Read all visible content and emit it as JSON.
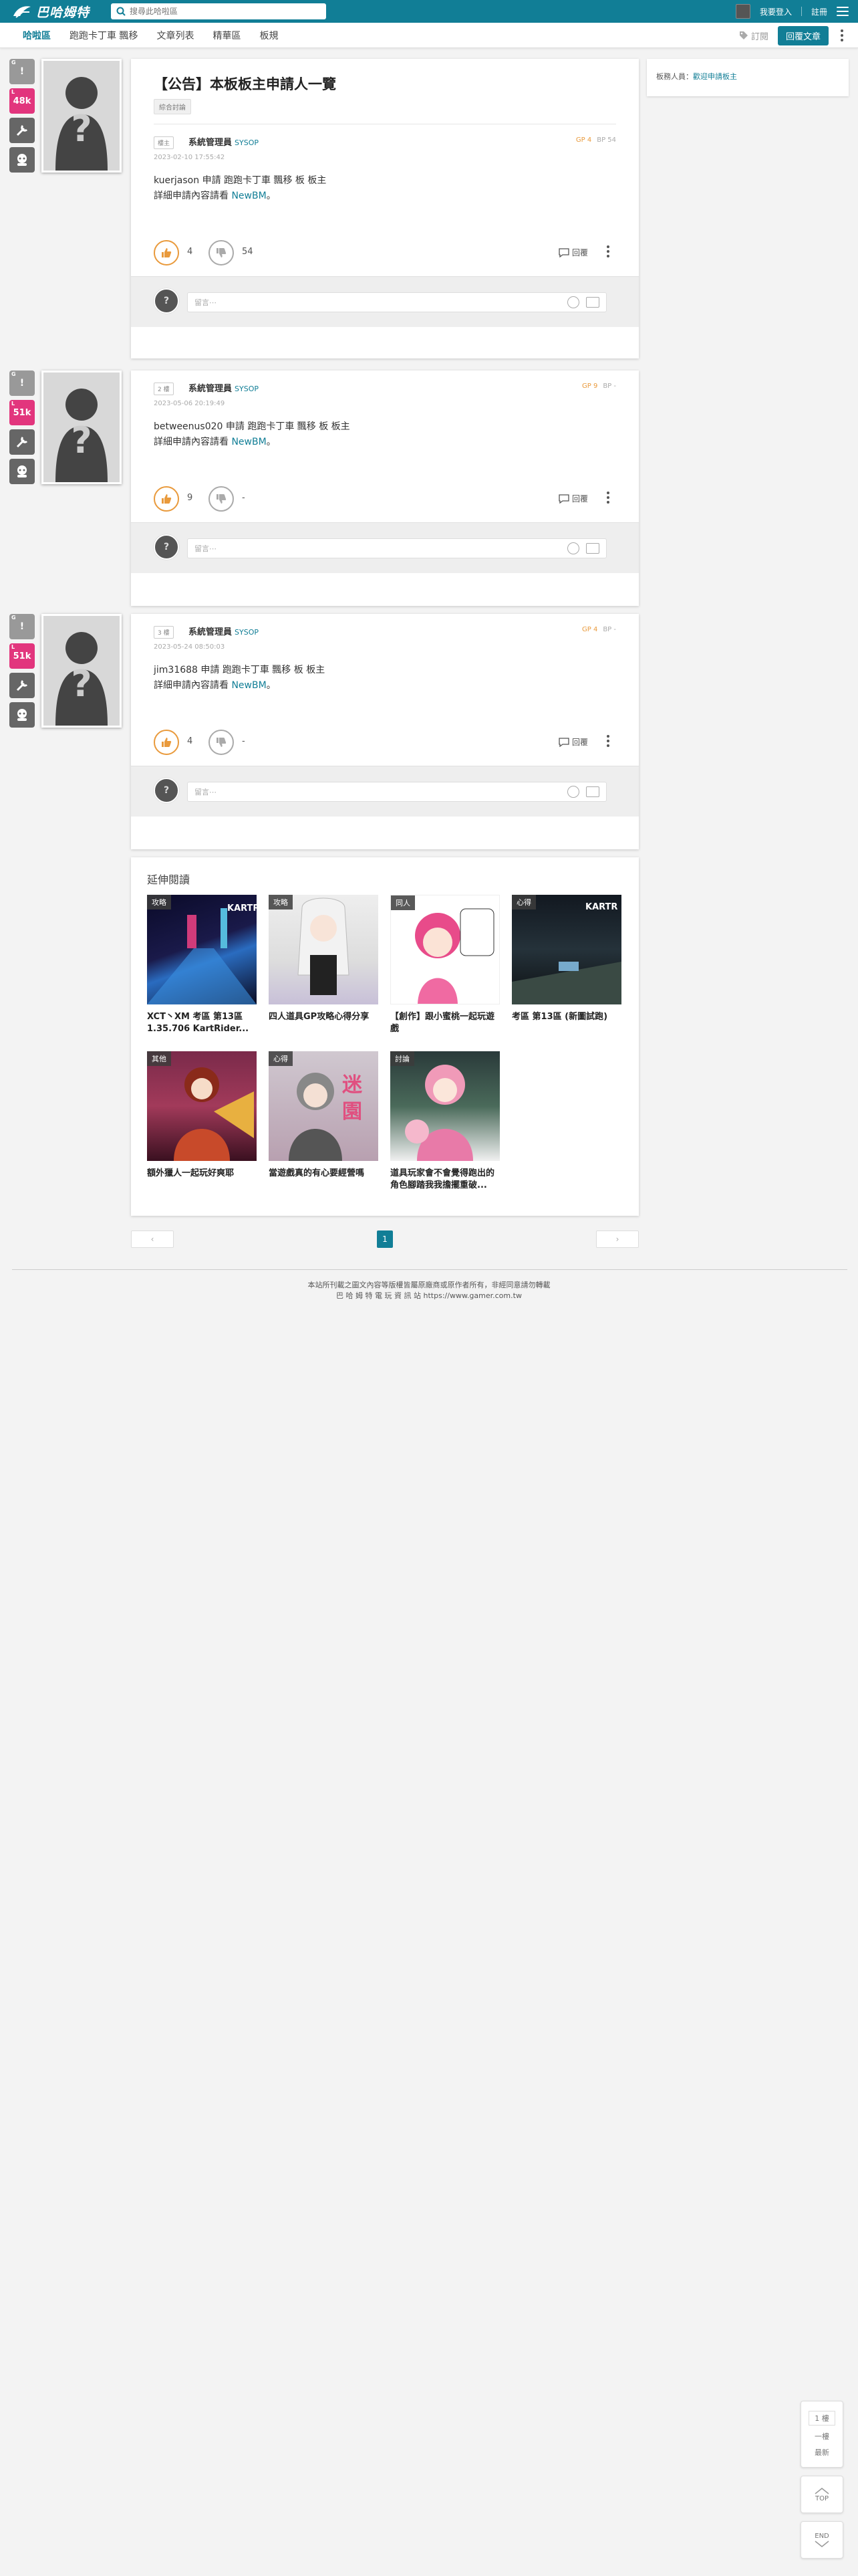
{
  "header": {
    "logo_text": "巴哈姆特",
    "search_placeholder": "搜尋此哈啦區",
    "login": "我要登入",
    "register": "註冊"
  },
  "nav": {
    "items": [
      "哈啦區",
      "跑跑卡丁車 飄移",
      "文章列表",
      "精華區",
      "板規"
    ],
    "subscribe": "訂閱",
    "reply": "回覆文章"
  },
  "sidebar": {
    "label": "板務人員：",
    "link": "歡迎申請板主"
  },
  "topic": {
    "title": "【公告】本板板主申請人一覽",
    "tag": "綜合討論"
  },
  "posts": [
    {
      "floor": "樓主",
      "author": "系統管理員",
      "uid": "SYSOP",
      "gp": "GP 4",
      "bp": "BP 54",
      "time": "2023-02-10 17:55:42",
      "line1": "kuerjason 申請 跑跑卡丁車 飄移 板 板主",
      "line2_prefix": "詳細申請內容請看 ",
      "line2_link": "NewBM",
      "line2_suffix": "。",
      "gp_count": "4",
      "bp_count": "54",
      "badges": {
        "top": "G",
        "mid": "48k"
      }
    },
    {
      "floor": "2 樓",
      "author": "系統管理員",
      "uid": "SYSOP",
      "gp": "GP 9",
      "bp": "BP -",
      "time": "2023-05-06 20:19:49",
      "line1": "betweenus020 申請 跑跑卡丁車 飄移 板 板主",
      "line2_prefix": "詳細申請內容請看 ",
      "line2_link": "NewBM",
      "line2_suffix": "。",
      "gp_count": "9",
      "bp_count": "-",
      "badges": {
        "top": "G",
        "mid": "51k"
      }
    },
    {
      "floor": "3 樓",
      "author": "系統管理員",
      "uid": "SYSOP",
      "gp": "GP 4",
      "bp": "BP -",
      "time": "2023-05-24 08:50:03",
      "line1": "jim31688 申請 跑跑卡丁車 飄移 板 板主",
      "line2_prefix": "詳細申請內容請看 ",
      "line2_link": "NewBM",
      "line2_suffix": "。",
      "gp_count": "4",
      "bp_count": "-",
      "badges": {
        "top": "G",
        "mid": "51k"
      }
    }
  ],
  "post_ui": {
    "reply": "回覆",
    "comment_placeholder": "留言⋯"
  },
  "related": {
    "heading": "延伸閱讀",
    "cards": [
      {
        "tag": "攻略",
        "title": "XCT丶XM 考區 第13區 1.35.706 KartRider..."
      },
      {
        "tag": "攻略",
        "title": "四人道具GP攻略心得分享"
      },
      {
        "tag": "同人",
        "title": "【創作】跟小蜜桃一起玩遊戲"
      },
      {
        "tag": "心得",
        "title": "考區 第13區 (新圖試跑)"
      },
      {
        "tag": "其他",
        "title": "額外獵人一起玩好爽耶"
      },
      {
        "tag": "心得",
        "title": "當遊戲真的有心要經營嗎"
      },
      {
        "tag": "討論",
        "title": "道具玩家會不會覺得跑出的角色腳踏我我擔擺重破..."
      }
    ]
  },
  "pager": {
    "prev": "‹",
    "current": "1",
    "next": "›"
  },
  "footer": {
    "line1": "本站所刊載之圖文內容等版權皆屬原廠商或原作者所有，非經同意請勿轉載",
    "line2": "巴 哈 姆 特 電 玩 資 訊 站 https://www.gamer.com.tw"
  },
  "floatnav": {
    "floor": "1 樓",
    "first": "一樓",
    "latest": "最新",
    "top": "TOP",
    "end": "END"
  },
  "colors": {
    "brand": "#117e96",
    "gp": "#e99a3c",
    "badge_pink": "#e2357d"
  }
}
